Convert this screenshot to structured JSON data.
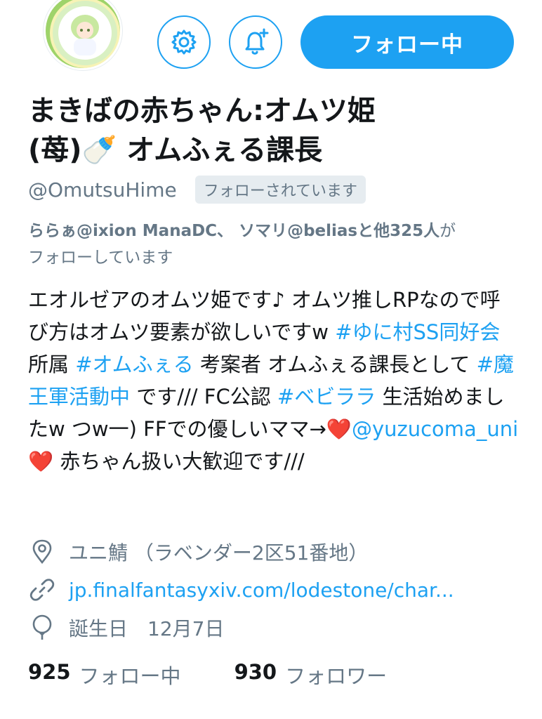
{
  "header": {
    "follow_label": "フォロー中"
  },
  "profile": {
    "name_line1": "まきばの赤ちゃん:オムツ姫",
    "name_line2": "(苺)🍼 オムふぇる課長",
    "handle": "@OmutsuHime",
    "follows_you": "フォローされています",
    "followed_by_names": "ららぁ@ixion ManaDC、 ソマリ@beliasと他325人",
    "followed_by_suffix": "が",
    "followed_by_line2": "フォローしています"
  },
  "bio": {
    "t1": "エオルゼアのオムツ姫です♪ オムツ推しRPなので呼び方はオムツ要素が欲しいですw ",
    "tag1": "#ゆに村SS同好会",
    "t2": " 所属 ",
    "tag2": "#オムふぇる",
    "t3": " 考案者 オムふぇる課長として ",
    "tag3": "#魔王軍活動中",
    "t4": " です/// FC公認 ",
    "tag4": "#ベビララ",
    "t5": " 生活始めましたw つw一) FFでの優しいママ→",
    "heart1": "❤️",
    "mention": "@yuzucoma_uni",
    "heart2": "❤️",
    "t6": " 赤ちゃん扱い大歓迎です///"
  },
  "meta": {
    "location": "ユニ鯖 （ラベンダー2区51番地）",
    "url": "jp.finalfantasyxiv.com/lodestone/char...",
    "birthday": "誕生日　12月7日"
  },
  "stats": {
    "following_count": "925",
    "following_label": "フォロー中",
    "followers_count": "930",
    "followers_label": "フォロワー"
  },
  "colors": {
    "accent": "#1da1f2",
    "text": "#14171a",
    "muted": "#657786"
  }
}
